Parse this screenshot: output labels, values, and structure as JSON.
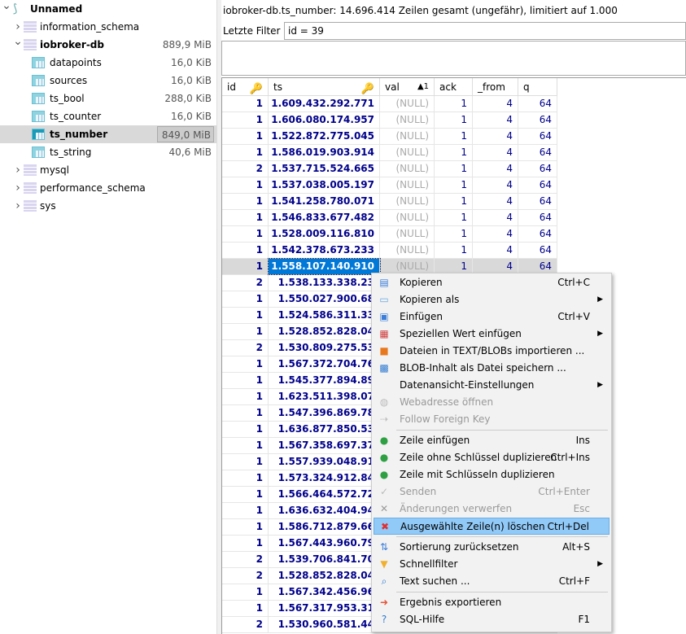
{
  "tree": {
    "root": "Unnamed",
    "databases": [
      {
        "name": "information_schema"
      },
      {
        "name": "iobroker-db",
        "size": "889,9 MiB",
        "expanded": true,
        "tables": [
          {
            "name": "datapoints",
            "size": "16,0 KiB"
          },
          {
            "name": "sources",
            "size": "16,0 KiB"
          },
          {
            "name": "ts_bool",
            "size": "288,0 KiB"
          },
          {
            "name": "ts_counter",
            "size": "16,0 KiB"
          },
          {
            "name": "ts_number",
            "size": "849,0 MiB",
            "selected": true
          },
          {
            "name": "ts_string",
            "size": "40,6 MiB"
          }
        ]
      },
      {
        "name": "mysql"
      },
      {
        "name": "performance_schema"
      },
      {
        "name": "sys"
      }
    ]
  },
  "status": "iobroker-db.ts_number: 14.696.414 Zeilen gesamt (ungefähr), limitiert auf 1.000",
  "filter": {
    "label": "Letzte Filter",
    "value": "id = 39"
  },
  "grid": {
    "columns": [
      "id",
      "ts",
      "val",
      "ack",
      "_from",
      "q"
    ],
    "sort_indicator": "▲1",
    "rows": [
      [
        "1",
        "1.609.432.292.771",
        "(NULL)",
        "1",
        "4",
        "64"
      ],
      [
        "1",
        "1.606.080.174.957",
        "(NULL)",
        "1",
        "4",
        "64"
      ],
      [
        "1",
        "1.522.872.775.045",
        "(NULL)",
        "1",
        "4",
        "64"
      ],
      [
        "1",
        "1.586.019.903.914",
        "(NULL)",
        "1",
        "4",
        "64"
      ],
      [
        "2",
        "1.537.715.524.665",
        "(NULL)",
        "1",
        "4",
        "64"
      ],
      [
        "1",
        "1.537.038.005.197",
        "(NULL)",
        "1",
        "4",
        "64"
      ],
      [
        "1",
        "1.541.258.780.071",
        "(NULL)",
        "1",
        "4",
        "64"
      ],
      [
        "1",
        "1.546.833.677.482",
        "(NULL)",
        "1",
        "4",
        "64"
      ],
      [
        "1",
        "1.528.009.116.810",
        "(NULL)",
        "1",
        "4",
        "64"
      ],
      [
        "1",
        "1.542.378.673.233",
        "(NULL)",
        "1",
        "4",
        "64"
      ],
      [
        "1",
        "1.558.107.140.910",
        "(NULL)",
        "1",
        "4",
        "64"
      ],
      [
        "2",
        "1.538.133.338.23"
      ],
      [
        "1",
        "1.550.027.900.68"
      ],
      [
        "1",
        "1.524.586.311.33"
      ],
      [
        "1",
        "1.528.852.828.04"
      ],
      [
        "2",
        "1.530.809.275.53"
      ],
      [
        "1",
        "1.567.372.704.76"
      ],
      [
        "1",
        "1.545.377.894.89"
      ],
      [
        "1",
        "1.623.511.398.07"
      ],
      [
        "1",
        "1.547.396.869.78"
      ],
      [
        "1",
        "1.636.877.850.53"
      ],
      [
        "1",
        "1.567.358.697.37"
      ],
      [
        "1",
        "1.557.939.048.91"
      ],
      [
        "1",
        "1.573.324.912.84"
      ],
      [
        "1",
        "1.566.464.572.72"
      ],
      [
        "1",
        "1.636.632.404.94"
      ],
      [
        "1",
        "1.586.712.879.66"
      ],
      [
        "1",
        "1.567.443.960.79"
      ],
      [
        "2",
        "1.539.706.841.70"
      ],
      [
        "2",
        "1.528.852.828.04"
      ],
      [
        "1",
        "1.567.342.456.96"
      ],
      [
        "1",
        "1.567.317.953.31"
      ],
      [
        "2",
        "1.530.960.581.44"
      ]
    ],
    "selected_row": 10
  },
  "menu": {
    "items": [
      {
        "label": "Kopieren",
        "shortcut": "Ctrl+C",
        "icon": "copy-icon",
        "glyph": "▤",
        "color": "#3b7dd8"
      },
      {
        "label": "Kopieren als",
        "submenu": true,
        "icon": "copy-as-icon",
        "glyph": "▭",
        "color": "#6aa8e0"
      },
      {
        "label": "Einfügen",
        "shortcut": "Ctrl+V",
        "icon": "paste-icon",
        "glyph": "▣",
        "color": "#3b7dd8"
      },
      {
        "label": "Speziellen Wert einfügen",
        "submenu": true,
        "icon": "calendar-icon",
        "glyph": "▦",
        "color": "#d04040"
      },
      {
        "label": "Dateien in TEXT/BLOBs importieren ...",
        "icon": "image-import-icon",
        "glyph": "■",
        "color": "#e8781e"
      },
      {
        "label": "BLOB-Inhalt als Datei speichern ...",
        "icon": "save-icon",
        "glyph": "▩",
        "color": "#2f7ad0"
      },
      {
        "label": "Datenansicht-Einstellungen",
        "submenu": true
      },
      {
        "label": "Webadresse öffnen",
        "disabled": true,
        "icon": "globe-icon",
        "glyph": "◍",
        "color": "#bbb"
      },
      {
        "label": "Follow Foreign Key",
        "disabled": true,
        "icon": "foreign-key-icon",
        "glyph": "⇢",
        "color": "#bbb",
        "sep_after": true
      },
      {
        "label": "Zeile einfügen",
        "shortcut": "Ins",
        "icon": "add-icon",
        "glyph": "●",
        "color": "#2ea043"
      },
      {
        "label": "Zeile ohne Schlüssel duplizieren",
        "shortcut": "Ctrl+Ins",
        "icon": "add-icon",
        "glyph": "●",
        "color": "#2ea043"
      },
      {
        "label": "Zeile mit Schlüsseln duplizieren",
        "icon": "add-icon",
        "glyph": "●",
        "color": "#2ea043"
      },
      {
        "label": "Senden",
        "shortcut": "Ctrl+Enter",
        "disabled": true,
        "icon": "check-icon",
        "glyph": "✓",
        "color": "#bbb"
      },
      {
        "label": "Änderungen verwerfen",
        "shortcut": "Esc",
        "disabled": true,
        "icon": "cancel-icon",
        "glyph": "✕",
        "color": "#999"
      },
      {
        "label": "Ausgewählte Zeile(n) löschen",
        "shortcut": "Ctrl+Del",
        "highlighted": true,
        "icon": "delete-icon",
        "glyph": "✖",
        "color": "#e03030",
        "sep_after": true
      },
      {
        "label": "Sortierung zurücksetzen",
        "shortcut": "Alt+S",
        "icon": "sort-reset-icon",
        "glyph": "⇅",
        "color": "#3b7dd8"
      },
      {
        "label": "Schnellfilter",
        "submenu": true,
        "icon": "filter-icon",
        "glyph": "▼",
        "color": "#f0b030"
      },
      {
        "label": "Text suchen ...",
        "shortcut": "Ctrl+F",
        "icon": "search-icon",
        "glyph": "⌕",
        "color": "#2f7ad0",
        "sep_after": true
      },
      {
        "label": "Ergebnis exportieren",
        "icon": "export-icon",
        "glyph": "➜",
        "color": "#e8553a"
      },
      {
        "label": "SQL-Hilfe",
        "shortcut": "F1",
        "icon": "help-icon",
        "glyph": "?",
        "color": "#2f7ad0"
      }
    ]
  }
}
